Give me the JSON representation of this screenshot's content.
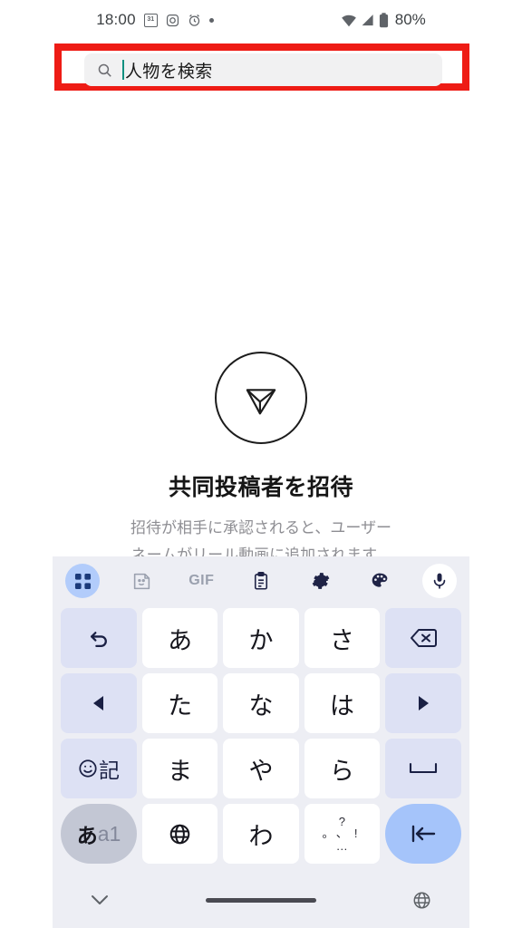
{
  "status_bar": {
    "time": "18:00",
    "battery_percent": "80%",
    "left_icons": [
      "calendar-31-icon",
      "instagram-icon",
      "alarm-clock-icon",
      "dot-icon"
    ],
    "calendar_day": "31",
    "right_icons": [
      "wifi-icon",
      "signal-icon",
      "battery-icon"
    ]
  },
  "search": {
    "value": "人物を検索",
    "placeholder": "人物を検索",
    "icon": "search-icon",
    "caret_color": "#0f9080",
    "highlight_color": "#ee1c15"
  },
  "empty_state": {
    "icon": "send-paper-plane-icon",
    "title": "共同投稿者を招待",
    "subtitle_line1": "招待が相手に承認されると、ユーザー",
    "subtitle_line2": "ネームがリール動画に追加されます。"
  },
  "keyboard": {
    "toolbar": [
      {
        "name": "apps-grid-icon",
        "label": "",
        "active": true
      },
      {
        "name": "sticker-icon",
        "label": "",
        "active": false
      },
      {
        "name": "gif-icon",
        "label": "GIF",
        "active": false
      },
      {
        "name": "clipboard-icon",
        "label": "",
        "active": false
      },
      {
        "name": "gear-icon",
        "label": "",
        "active": false
      },
      {
        "name": "palette-icon",
        "label": "",
        "active": false
      },
      {
        "name": "mic-icon",
        "label": "",
        "active": false
      }
    ],
    "rows": [
      [
        {
          "name": "undo-key",
          "label": "↺",
          "type": "func"
        },
        {
          "name": "key-a",
          "label": "あ",
          "type": "char"
        },
        {
          "name": "key-ka",
          "label": "か",
          "type": "char"
        },
        {
          "name": "key-sa",
          "label": "さ",
          "type": "char"
        },
        {
          "name": "backspace-key",
          "label": "⌫",
          "type": "func"
        }
      ],
      [
        {
          "name": "cursor-left-key",
          "label": "◀",
          "type": "func"
        },
        {
          "name": "key-ta",
          "label": "た",
          "type": "char"
        },
        {
          "name": "key-na",
          "label": "な",
          "type": "char"
        },
        {
          "name": "key-ha",
          "label": "は",
          "type": "char"
        },
        {
          "name": "cursor-right-key",
          "label": "▶",
          "type": "func"
        }
      ],
      [
        {
          "name": "emoji-symbol-key",
          "label": "☺記",
          "type": "func"
        },
        {
          "name": "key-ma",
          "label": "ま",
          "type": "char"
        },
        {
          "name": "key-ya",
          "label": "や",
          "type": "char"
        },
        {
          "name": "key-ra",
          "label": "ら",
          "type": "char"
        },
        {
          "name": "space-key",
          "label": "␣",
          "type": "func"
        }
      ],
      [
        {
          "name": "input-mode-key",
          "label": "あa1",
          "type": "pill"
        },
        {
          "name": "globe-language-key",
          "label": "🌐",
          "type": "char"
        },
        {
          "name": "key-wa",
          "label": "わ",
          "type": "char"
        },
        {
          "name": "punctuation-key",
          "label": "、。？！…",
          "type": "punct"
        },
        {
          "name": "enter-key",
          "label": "↵",
          "type": "enter"
        }
      ]
    ],
    "punctuation_marks": [
      "",
      "?",
      "",
      "。",
      "、",
      "!",
      "",
      "…",
      ""
    ],
    "input_mode_primary": "あ",
    "input_mode_secondary": "a1"
  },
  "nav_bar": {
    "hide_keyboard_icon": "chevron-down-icon",
    "home_indicator": "home-indicator",
    "language_icon": "globe-icon"
  }
}
